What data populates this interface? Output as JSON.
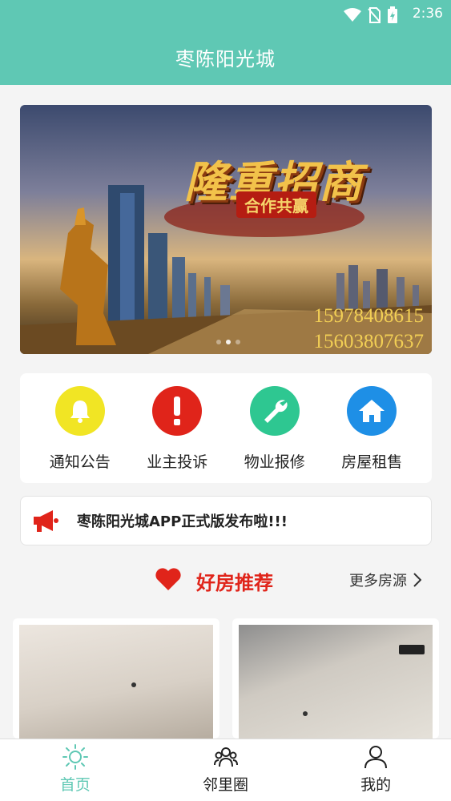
{
  "status_bar": {
    "time": "2:36",
    "icons": [
      "wifi-icon",
      "no-sim-icon",
      "battery-charging-icon"
    ]
  },
  "header": {
    "title": "枣陈阳光城"
  },
  "banner": {
    "headline": "隆重招商",
    "subheadline": "合作共赢",
    "phones": [
      "15978408615",
      "15603807637"
    ],
    "slide_count": 3,
    "active_slide": 1
  },
  "quick_menu": [
    {
      "label": "通知公告",
      "icon": "bell-icon",
      "color": "#f1e524"
    },
    {
      "label": "业主投诉",
      "icon": "exclamation-icon",
      "color": "#e0241a"
    },
    {
      "label": "物业报修",
      "icon": "wrench-icon",
      "color": "#2ec791"
    },
    {
      "label": "房屋租售",
      "icon": "house-icon",
      "color": "#1e8fe6"
    }
  ],
  "notice": {
    "text": "枣陈阳光城APP正式版发布啦!!!",
    "icon": "megaphone-icon"
  },
  "recommend": {
    "title": "好房推荐",
    "more_label": "更多房源",
    "accent": "#e0241a"
  },
  "bottom_nav": [
    {
      "label": "首页",
      "icon": "sun-icon",
      "active": true
    },
    {
      "label": "邻里圈",
      "icon": "community-icon",
      "active": false
    },
    {
      "label": "我的",
      "icon": "user-icon",
      "active": false
    }
  ],
  "colors": {
    "primary": "#5fc8b4"
  }
}
